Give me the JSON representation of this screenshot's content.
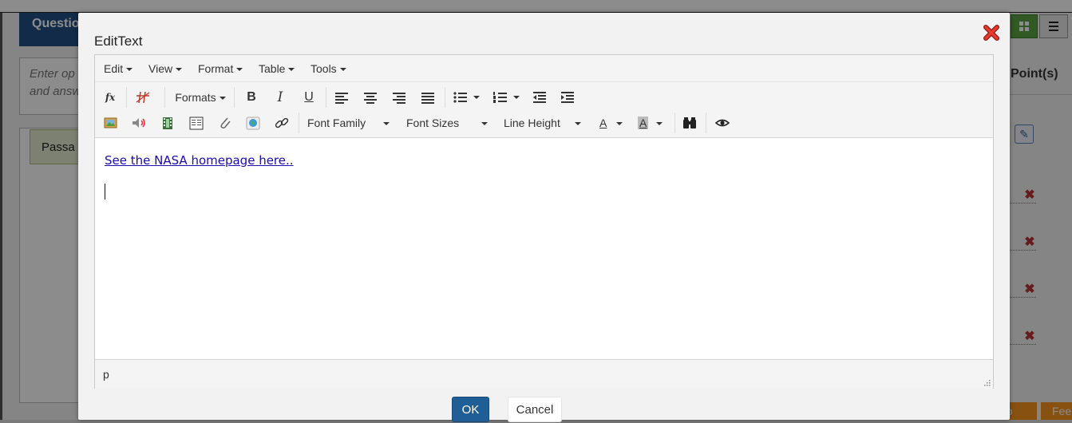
{
  "background": {
    "question_tab": "Questio",
    "enter_text": "Enter op and answ",
    "passage_tab": "Passa",
    "points_header": "Point(s)",
    "help_button": "Help",
    "feedback_button": "Fee"
  },
  "dialog": {
    "title": "EditText",
    "menu": [
      {
        "label": "Edit"
      },
      {
        "label": "View"
      },
      {
        "label": "Format"
      },
      {
        "label": "Table"
      },
      {
        "label": "Tools"
      }
    ],
    "toolbar": {
      "formats_label": "Formats",
      "font_family_label": "Font Family",
      "font_sizes_label": "Font Sizes",
      "line_height_label": "Line Height",
      "text_color_label": "A",
      "bg_color_label": "A",
      "bold_label": "B",
      "italic_label": "I",
      "underline_label": "U",
      "formula_label": "fx"
    },
    "content": {
      "link_text": "See the NASA homepage here.",
      "after_link": "."
    },
    "status_path": "p",
    "ok_label": "OK",
    "cancel_label": "Cancel"
  },
  "colors": {
    "primary_button": "#1f5e96",
    "link": "#1a0dab",
    "close_red": "#d9261c",
    "help_orange": "#f7941d"
  }
}
